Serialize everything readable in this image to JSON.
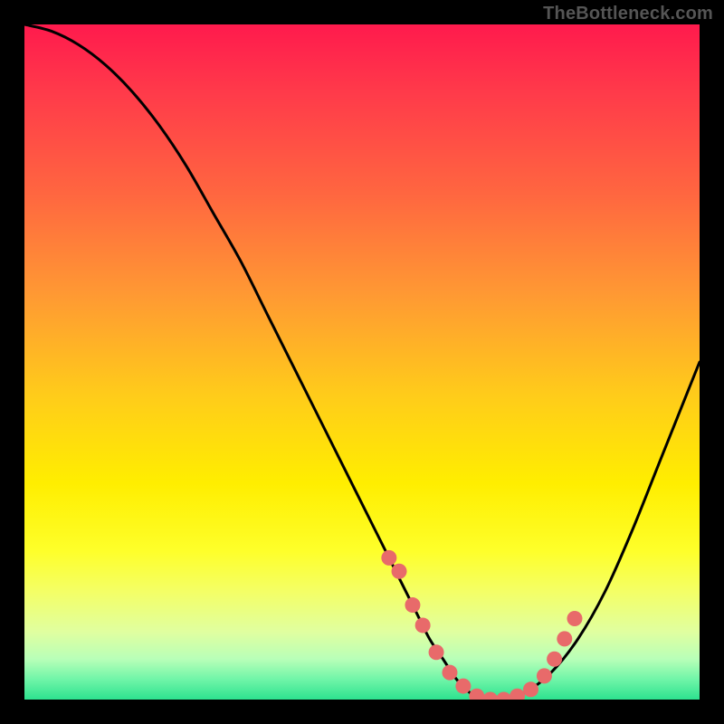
{
  "watermark": "TheBottleneck.com",
  "chart_data": {
    "type": "line",
    "title": "",
    "xlabel": "",
    "ylabel": "",
    "xlim": [
      0,
      100
    ],
    "ylim": [
      0,
      100
    ],
    "series": [
      {
        "name": "bottleneck-curve",
        "x": [
          0,
          4,
          8,
          12,
          16,
          20,
          24,
          28,
          32,
          36,
          40,
          44,
          48,
          52,
          54,
          56,
          58,
          60,
          62,
          64,
          66,
          68,
          70,
          74,
          78,
          82,
          86,
          90,
          94,
          98,
          100
        ],
        "y": [
          100,
          99,
          97,
          94,
          90,
          85,
          79,
          72,
          65,
          57,
          49,
          41,
          33,
          25,
          21,
          17,
          13,
          9,
          6,
          3,
          1,
          0,
          0,
          1,
          4,
          9,
          16,
          25,
          35,
          45,
          50
        ]
      }
    ],
    "markers": {
      "name": "highlight-dots",
      "color": "#e86a6a",
      "x": [
        54,
        55.5,
        57.5,
        59,
        61,
        63,
        65,
        67,
        69,
        71,
        73,
        75,
        77,
        78.5,
        80,
        81.5
      ],
      "y": [
        21,
        19,
        14,
        11,
        7,
        4,
        2,
        0.5,
        0,
        0,
        0.5,
        1.5,
        3.5,
        6,
        9,
        12
      ]
    }
  }
}
